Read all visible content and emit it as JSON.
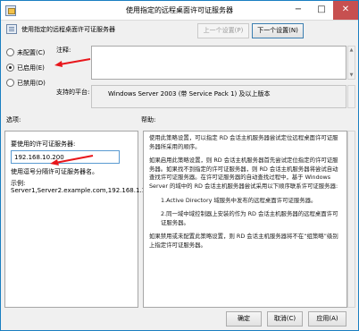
{
  "window": {
    "title": "使用指定的远程桌面许可证服务器",
    "controls": {
      "minimize": "−",
      "maximize": "□",
      "close": "✕"
    }
  },
  "header": {
    "policy_name": "使用指定的远程桌面许可证服务器",
    "prev_button": "上一个设置(P)",
    "next_button": "下一个设置(N)"
  },
  "state": {
    "options": [
      {
        "label": "未配置(C)",
        "checked": false
      },
      {
        "label": "已启用(E)",
        "checked": true
      },
      {
        "label": "已禁用(D)",
        "checked": false
      }
    ]
  },
  "note": {
    "label": "注释:",
    "value": ""
  },
  "platform": {
    "label": "支持的平台:",
    "value": "Windows Server 2003 (带 Service Pack 1) 及以上版本"
  },
  "sections": {
    "options_label": "选项:",
    "help_label": "帮助:"
  },
  "options_panel": {
    "field_label": "要使用的许可证服务器:",
    "field_value": "192.168.10.200",
    "hint": "使用逗号分隔许可证服务器名。",
    "example_title": "示例:",
    "example_value": "Server1,Server2.example.com,192.168.1.1"
  },
  "help": {
    "paragraphs": [
      "使用此策略设置，可以指定 RD 会话主机服务器尝试定位远程桌面许可证服务器所采用的顺序。",
      "如果启用此策略设置，则 RD 会话主机服务器首先尝试定位指定的许可证服务器。如果找不到指定的许可证服务器，则 RD 会话主机服务器将尝试自动查找许可证服务器。在许可证服务器的自动查找过程中，基于 Windows Server 的域中的 RD 会话主机服务器尝试采用以下顺序联系许可证服务器:",
      "1.Active Directory 域服务中发布的远程桌面许可证服务器。",
      "2.同一域中域控制器上安装的作为 RD 会话主机服务器的远程桌面许可证服务器。",
      "如果禁用或未配置此策略设置，则 RD 会话主机服务器将不在“组策略”级别上指定许可证服务器。"
    ]
  },
  "footer": {
    "ok": "确定",
    "cancel": "取消(C)",
    "apply": "应用(A)"
  },
  "colors": {
    "arrow": "#e8161b",
    "accent_border": "#1a7fc1",
    "close_button": "#c75050"
  },
  "icons": [
    "window-policy-icon",
    "policy-icon",
    "red-arrow-annotation"
  ]
}
